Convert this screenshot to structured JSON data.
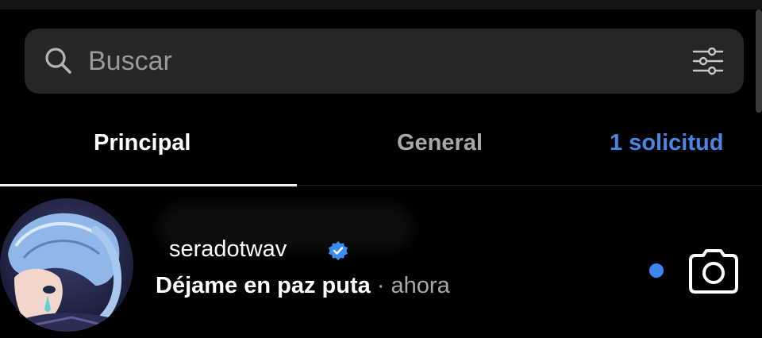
{
  "search": {
    "placeholder": "Buscar",
    "value": ""
  },
  "tabs": [
    {
      "label": "Principal",
      "active": true
    },
    {
      "label": "General",
      "active": false
    },
    {
      "label": "1 solicitud",
      "active": false,
      "color": "#4b86e6"
    }
  ],
  "threads": [
    {
      "username": "seradotwav",
      "verified": true,
      "preview": "Déjame en paz puta",
      "separator": "·",
      "time": "ahora",
      "unread": true,
      "icons": [
        "avatar",
        "verified-icon",
        "unread-dot",
        "camera-icon"
      ]
    }
  ],
  "colors": {
    "background": "#000000",
    "search_bg": "#262626",
    "accent_blue": "#3b86f0",
    "muted_text": "#a8a8a8"
  }
}
